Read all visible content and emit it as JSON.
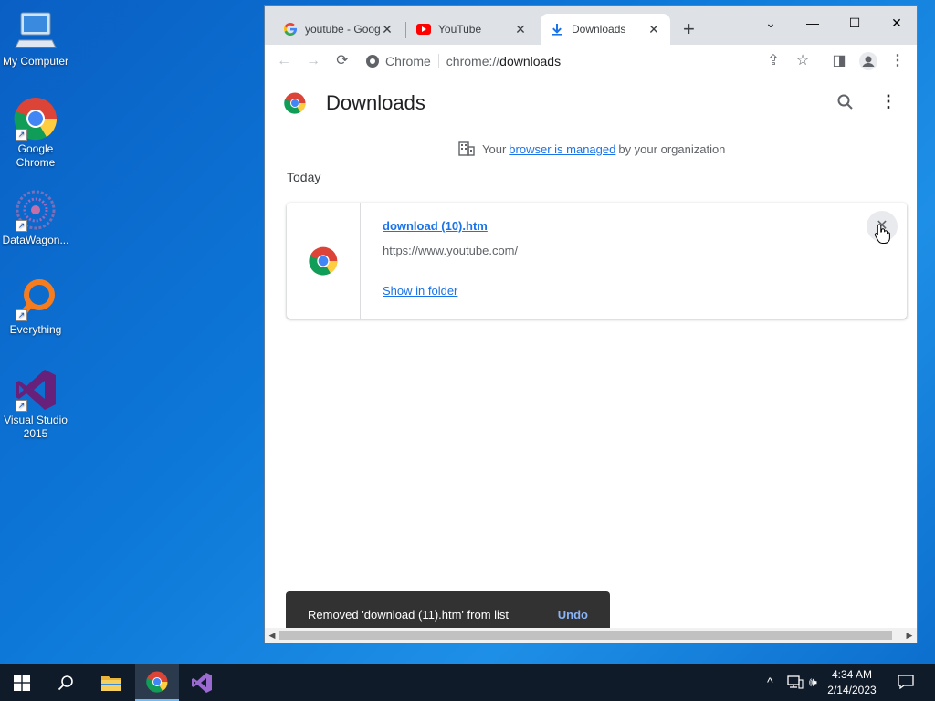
{
  "desktop": {
    "icons": [
      {
        "label": "My Computer"
      },
      {
        "label": "Google Chrome"
      },
      {
        "label": "DataWagon..."
      },
      {
        "label": "Everything"
      },
      {
        "label": "Visual Studio 2015"
      }
    ]
  },
  "browser": {
    "tabs": [
      {
        "title": "youtube - Google Search",
        "icon": "google-icon"
      },
      {
        "title": "YouTube",
        "icon": "youtube-icon"
      },
      {
        "title": "Downloads",
        "icon": "download-icon"
      }
    ],
    "omnibox": {
      "chip": "Chrome",
      "url_prefix": "chrome://",
      "url_host": "downloads"
    }
  },
  "downloads_page": {
    "title": "Downloads",
    "managed_prefix": "Your",
    "managed_link": "browser is managed",
    "managed_suffix": "by your organization",
    "section": "Today",
    "item": {
      "file_name": "download (10).htm",
      "url": "https://www.youtube.com/",
      "action": "Show in folder",
      "remove": "✕"
    },
    "toast": {
      "message": "Removed 'download (11).htm' from list",
      "action": "Undo"
    }
  },
  "taskbar": {
    "time": "4:34 AM",
    "date": "2/14/2023"
  },
  "colors": {
    "accent": "#1a73e8",
    "desktop": "#0d78d8",
    "taskbar": "#101b2a"
  }
}
